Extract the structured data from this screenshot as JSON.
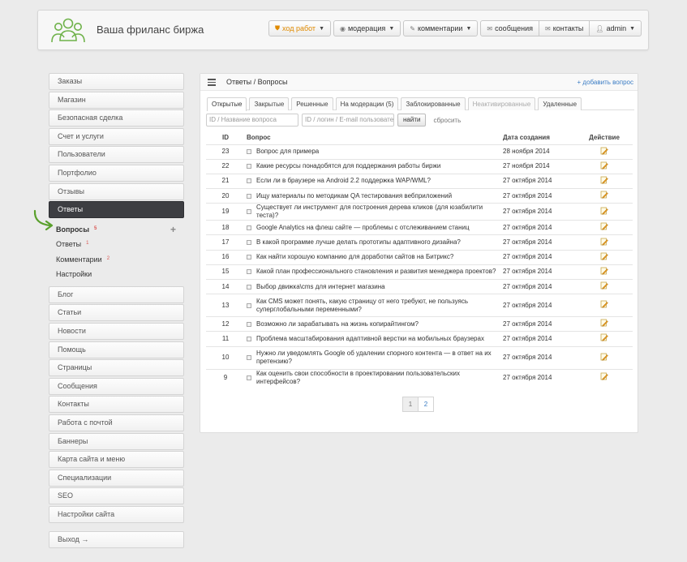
{
  "header": {
    "site_title": "Ваша фриланс биржа",
    "nav": [
      {
        "label": "ход работ",
        "icon": "shield-icon"
      },
      {
        "label": "модерация",
        "icon": "eye-icon"
      },
      {
        "label": "комментарии",
        "icon": "pencil-icon"
      },
      {
        "label": "сообщения",
        "icon": "envelope-icon"
      },
      {
        "label": "контакты",
        "icon": "envelope-icon"
      },
      {
        "label": "admin",
        "icon": "user-icon"
      }
    ]
  },
  "sidebar": {
    "items_top": [
      "Заказы",
      "Магазин",
      "Безопасная сделка",
      "Счет и услуги",
      "Пользователи",
      "Портфолио",
      "Отзывы"
    ],
    "active": "Ответы",
    "submenu": [
      {
        "label": "Вопросы",
        "count": "5"
      },
      {
        "label": "Ответы",
        "count": "1"
      },
      {
        "label": "Комментарии",
        "count": "2"
      },
      {
        "label": "Настройки",
        "count": ""
      }
    ],
    "items_bottom": [
      "Блог",
      "Статьи",
      "Новости",
      "Помощь",
      "Страницы",
      "Сообщения",
      "Контакты",
      "Работа с почтой",
      "Баннеры",
      "Карта сайта и меню",
      "Специализации",
      "SEO",
      "Настройки сайта"
    ],
    "logout": "Выход →"
  },
  "panel": {
    "title": "Ответы / Вопросы",
    "add_link": "+ добавить вопрос",
    "tabs": [
      "Открытые",
      "Закрытые",
      "Решенные",
      "На модерации (5)",
      "Заблокированные",
      "Неактивированные",
      "Удаленные"
    ],
    "filter": {
      "title_placeholder": "ID / Название вопроса",
      "user_placeholder": "ID / логин / E-mail пользователя",
      "search_button": "найти",
      "reset_link": "сбросить"
    },
    "columns": {
      "id": "ID",
      "question": "Вопрос",
      "date": "Дата создания",
      "action": "Действие"
    },
    "rows": [
      {
        "id": "23",
        "question": "Вопрос для примера",
        "date": "28 ноября 2014"
      },
      {
        "id": "22",
        "question": "Какие ресурсы понадобятся для поддержания работы биржи",
        "date": "27 ноября 2014"
      },
      {
        "id": "21",
        "question": "Если ли в браузере на Android 2.2 поддержка WAP/WML?",
        "date": "27 октября 2014"
      },
      {
        "id": "20",
        "question": "Ищу материалы по методикам QA тестирования вебприложений",
        "date": "27 октября 2014"
      },
      {
        "id": "19",
        "question": "Существует ли инструмент для построения дерева кликов (для юзабилити теста)?",
        "date": "27 октября 2014"
      },
      {
        "id": "18",
        "question": "Google Analytics на флеш сайте — проблемы с отслеживанием станиц",
        "date": "27 октября 2014"
      },
      {
        "id": "17",
        "question": "В какой программе лучше делать прототипы адаптивного дизайна?",
        "date": "27 октября 2014"
      },
      {
        "id": "16",
        "question": "Как найти хорошую компанию для доработки сайтов на Битрикс?",
        "date": "27 октября 2014"
      },
      {
        "id": "15",
        "question": "Какой план профессионального становления и развития менеджера проектов?",
        "date": "27 октября 2014"
      },
      {
        "id": "14",
        "question": "Выбор движка\\cms для интернет магазина",
        "date": "27 октября 2014"
      },
      {
        "id": "13",
        "question": "Как CMS может понять, какую страницу от него требуют, не пользуясь суперглобальными переменными?",
        "date": "27 октября 2014"
      },
      {
        "id": "12",
        "question": "Возможно ли зарабатывать на жизнь копирайтингом?",
        "date": "27 октября 2014"
      },
      {
        "id": "11",
        "question": "Проблема масштабирования адаптивной верстки на мобильных браузерах",
        "date": "27 октября 2014"
      },
      {
        "id": "10",
        "question": "Нужно ли уведомлять Google об удалении спорного контента — в ответ на их претензию?",
        "date": "27 октября 2014"
      },
      {
        "id": "9",
        "question": "Как оценить свои способности в проектировании пользовательских интерфейсов?",
        "date": "27 октября 2014"
      }
    ],
    "pages": [
      "1",
      "2"
    ],
    "current_page": "1"
  },
  "colors": {
    "accent": "#3a7cc4",
    "active_bg": "#3d3e42",
    "arrow": "#5aa02c",
    "count": "#d9534f",
    "logo": "#6fb24a"
  }
}
